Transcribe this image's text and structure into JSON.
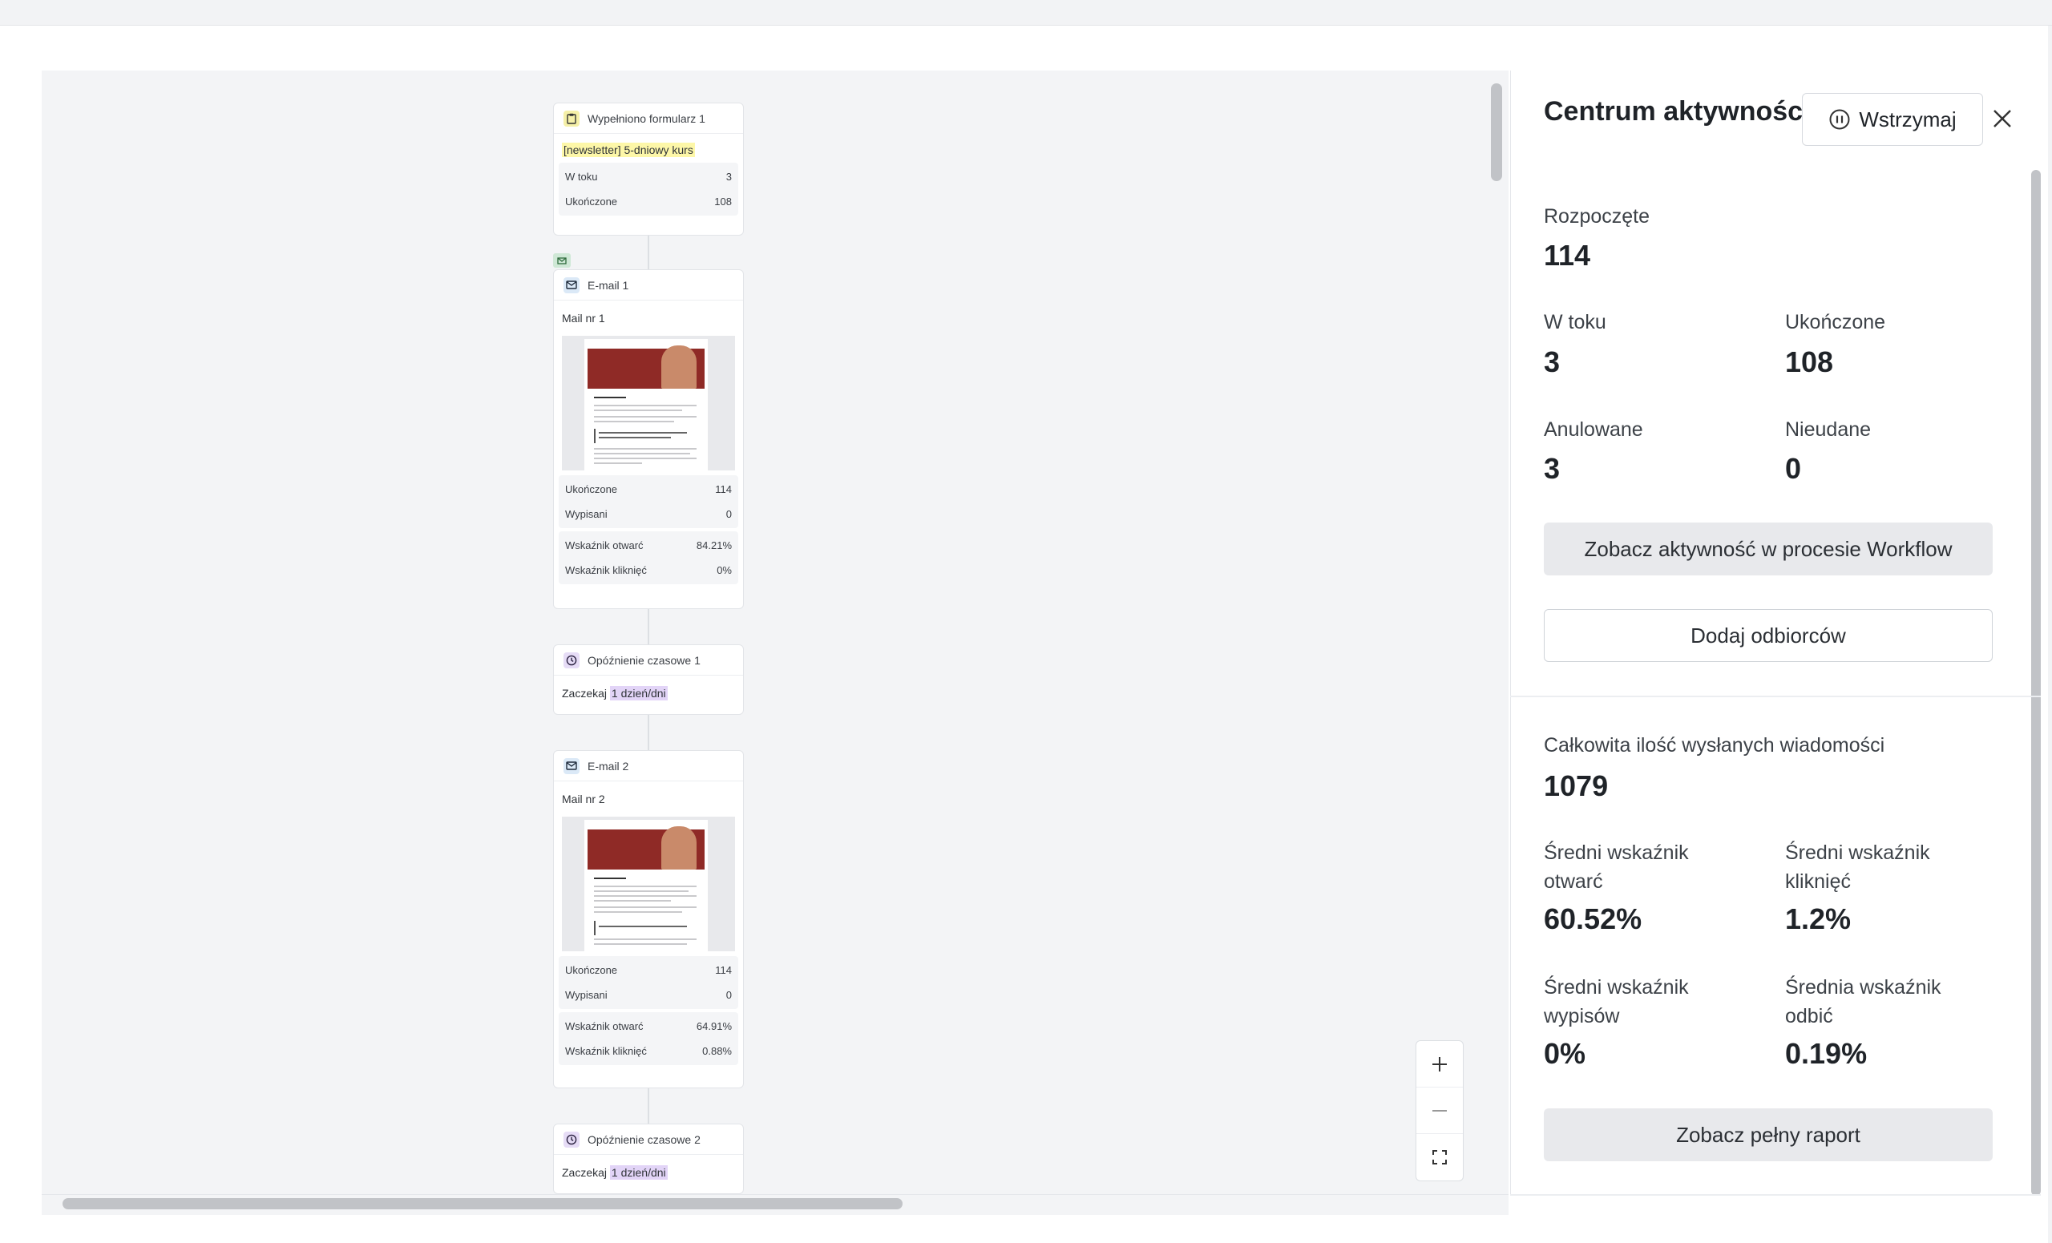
{
  "workflow": {
    "trigger_node": {
      "title": "Wypełniono formularz 1",
      "name": "[newsletter] 5-dniowy kurs",
      "stats": [
        {
          "label": "W toku",
          "value": "3"
        },
        {
          "label": "Ukończone",
          "value": "108"
        }
      ]
    },
    "email_1": {
      "title": "E-mail 1",
      "subject": "Mail nr 1",
      "stats_a": [
        {
          "label": "Ukończone",
          "value": "114"
        },
        {
          "label": "Wypisani",
          "value": "0"
        }
      ],
      "stats_b": [
        {
          "label": "Wskaźnik otwarć",
          "value": "84.21%"
        },
        {
          "label": "Wskaźnik kliknięć",
          "value": "0%"
        }
      ]
    },
    "delay_1": {
      "title": "Opóźnienie czasowe 1",
      "prefix": "Zaczekaj",
      "duration": "1 dzień/dni"
    },
    "email_2": {
      "title": "E-mail 2",
      "subject": "Mail nr 2",
      "stats_a": [
        {
          "label": "Ukończone",
          "value": "114"
        },
        {
          "label": "Wypisani",
          "value": "0"
        }
      ],
      "stats_b": [
        {
          "label": "Wskaźnik otwarć",
          "value": "64.91%"
        },
        {
          "label": "Wskaźnik kliknięć",
          "value": "0.88%"
        }
      ]
    },
    "delay_2": {
      "title": "Opóźnienie czasowe 2",
      "prefix": "Zaczekaj",
      "duration": "1 dzień/dni"
    }
  },
  "zoom": {
    "in_icon": "plus-icon",
    "out_icon": "minus-icon",
    "fit_icon": "fullscreen-icon"
  },
  "panel": {
    "title": "Centrum aktywności",
    "pause_label": "Wstrzymaj",
    "started_label": "Rozpoczęte",
    "started_value": "114",
    "in_progress_label": "W toku",
    "in_progress_value": "3",
    "completed_label": "Ukończone",
    "completed_value": "108",
    "cancelled_label": "Anulowane",
    "cancelled_value": "3",
    "failed_label": "Nieudane",
    "failed_value": "0",
    "view_activity_label": "Zobacz aktywność w procesie Workflow",
    "add_recipients_label": "Dodaj odbiorców",
    "total_sent_label": "Całkowita ilość wysłanych wiadomości",
    "total_sent_value": "1079",
    "avg_open_label": "Średni wskaźnik otwarć",
    "avg_open_value": "60.52%",
    "avg_click_label": "Średni wskaźnik kliknięć",
    "avg_click_value": "1.2%",
    "avg_unsub_label": "Średni wskaźnik wypisów",
    "avg_unsub_value": "0%",
    "avg_bounce_label": "Średnia wskaźnik odbić",
    "avg_bounce_value": "0.19%",
    "full_report_label": "Zobacz pełny raport"
  },
  "colors": {
    "accent_highlight_yellow": "#fdf7a8",
    "accent_highlight_purple": "#e2d4f7"
  }
}
